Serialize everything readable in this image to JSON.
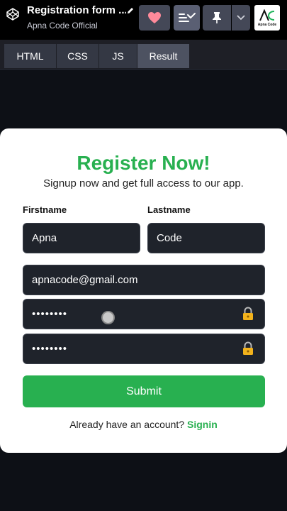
{
  "header": {
    "pen_title": "Registration form ...",
    "author": "Apna Code Official",
    "avatar_text": "Apna Code"
  },
  "tabs": [
    {
      "label": "HTML"
    },
    {
      "label": "CSS"
    },
    {
      "label": "JS"
    },
    {
      "label": "Result"
    }
  ],
  "form": {
    "title": "Register Now!",
    "subtitle": "Signup now and get full access to our app.",
    "firstname_label": "Firstname",
    "lastname_label": "Lastname",
    "firstname_value": "Apna",
    "lastname_value": "Code",
    "email_value": "apnacode@gmail.com",
    "password_value": "••••••••",
    "confirm_password_value": "••••••••",
    "submit_label": "Submit",
    "signin_prompt": "Already have an account?",
    "signin_link": "Signin"
  },
  "colors": {
    "accent_green": "#28b050",
    "input_bg": "#1f232b",
    "page_bg": "#0d1016",
    "heart": "#ff8a9a"
  },
  "icons": [
    "codepen-logo-icon",
    "pencil-icon",
    "heart-icon",
    "layout-icon",
    "pin-icon",
    "chevron-down-icon",
    "lock-icon"
  ]
}
